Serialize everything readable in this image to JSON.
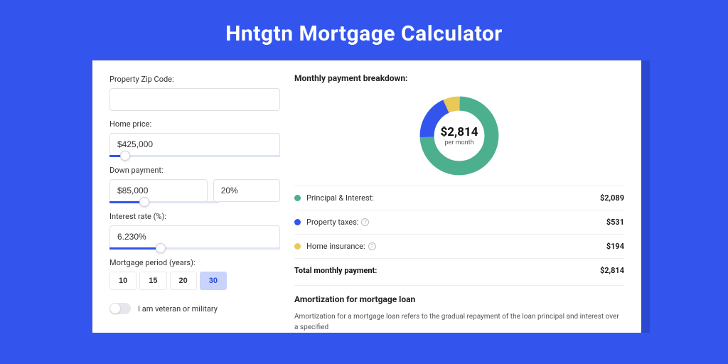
{
  "title": "Hntgtn Mortgage Calculator",
  "form": {
    "zip": {
      "label": "Property Zip Code:",
      "value": ""
    },
    "home_price": {
      "label": "Home price:",
      "value": "$425,000",
      "slider_pct": 9
    },
    "down_payment": {
      "label": "Down payment:",
      "amount": "$85,000",
      "pct": "20%",
      "slider_pct": 20
    },
    "interest": {
      "label": "Interest rate (%):",
      "value": "6.230%",
      "slider_pct": 30
    },
    "period": {
      "label": "Mortgage period (years):",
      "options": [
        "10",
        "15",
        "20",
        "30"
      ],
      "active": "30"
    },
    "veteran": {
      "label": "I am veteran or military"
    }
  },
  "breakdown": {
    "title": "Monthly payment breakdown:",
    "center_amount": "$2,814",
    "center_sub": "per month",
    "items": [
      {
        "label": "Principal & Interest:",
        "value": "$2,089",
        "color": "green",
        "info": false
      },
      {
        "label": "Property taxes:",
        "value": "$531",
        "color": "blue",
        "info": true
      },
      {
        "label": "Home insurance:",
        "value": "$194",
        "color": "yellow",
        "info": true
      }
    ],
    "total_label": "Total monthly payment:",
    "total_value": "$2,814"
  },
  "chart_data": {
    "type": "pie",
    "title": "Monthly payment breakdown",
    "series": [
      {
        "name": "Principal & Interest",
        "value": 2089,
        "color": "#4caf8e"
      },
      {
        "name": "Property taxes",
        "value": 531,
        "color": "#3355ee"
      },
      {
        "name": "Home insurance",
        "value": 194,
        "color": "#e8c957"
      }
    ],
    "total": 2814
  },
  "amort": {
    "title": "Amortization for mortgage loan",
    "body": "Amortization for a mortgage loan refers to the gradual repayment of the loan principal and interest over a specified"
  }
}
